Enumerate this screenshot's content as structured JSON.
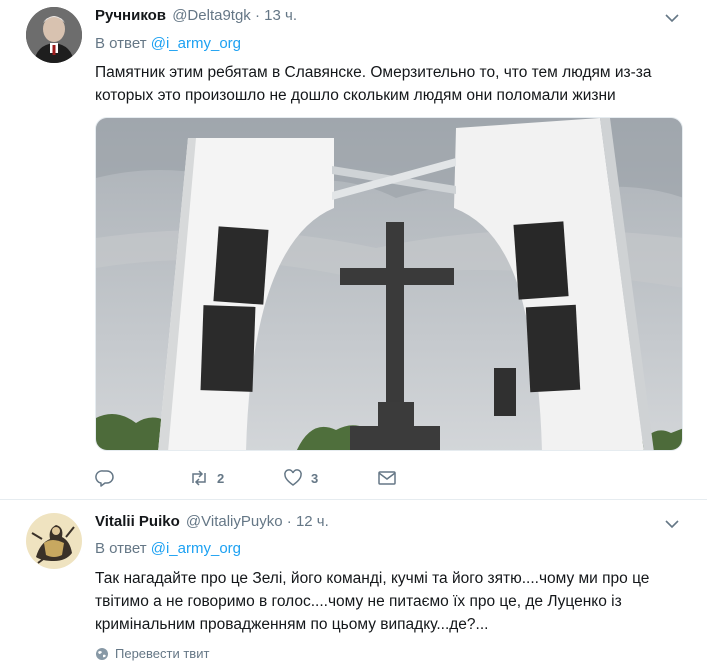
{
  "tweets": [
    {
      "author": {
        "name": "Ручников",
        "handle": "@Delta9tgk"
      },
      "separator": "·",
      "time": "13 ч.",
      "reply_prefix": "В ответ",
      "reply_handle": "@i_army_org",
      "text": "Памятник этим ребятам в Славянске. Омерзительно то, что тем людям из-за которых это произошло не дошло скольким людям они поломали жизни",
      "actions": {
        "replies": "",
        "retweets": "2",
        "likes": "3"
      }
    },
    {
      "author": {
        "name": "Vitalii Puiko",
        "handle": "@VitaliyPuyko"
      },
      "separator": "·",
      "time": "12 ч.",
      "reply_prefix": "В ответ",
      "reply_handle": "@i_army_org",
      "text": "Так нагадайте про це Зелі, його команді, кучмі та його зятю....чому ми про це твітимо а не говоримо в голос....чому не питаємо їх про це, де Луценко із кримінальним провадженням по цьому випадку...де?...",
      "translate_label": "Перевести твит"
    }
  ],
  "colors": {
    "link": "#1da1f2",
    "secondary": "#657786",
    "text": "#14171a",
    "divider": "#e6ecf0"
  },
  "icons": [
    "reply-icon",
    "retweet-icon",
    "like-icon",
    "message-icon",
    "chevron-down-icon",
    "globe-icon"
  ]
}
